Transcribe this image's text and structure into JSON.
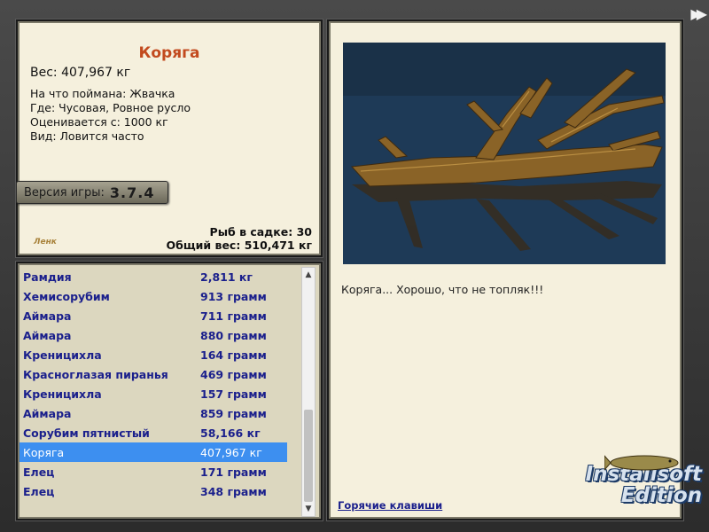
{
  "info": {
    "fish_name": "Коряга",
    "weight_line": "Вес: 407,967 кг",
    "details": [
      "На что поймана: Жвачка",
      "Где: Чусовая, Ровное русло",
      "Оценивается с: 1000 кг",
      "Вид: Ловится часто"
    ],
    "version_label": "Версия игры:",
    "version_value": "3.7.4",
    "logo_text": "Ленк",
    "fish_in_keepnet": "Рыб в садке: 30",
    "total_weight": "Общий вес: 510,471 кг"
  },
  "list": {
    "items": [
      {
        "name": "Рамдия",
        "weight": "2,811 кг"
      },
      {
        "name": "Хемисорубим",
        "weight": "913 грамм"
      },
      {
        "name": "Аймара",
        "weight": "711 грамм"
      },
      {
        "name": "Аймара",
        "weight": "880 грамм"
      },
      {
        "name": "Креницихла",
        "weight": "164 грамм"
      },
      {
        "name": "Красноглазая пиранья",
        "weight": "469 грамм"
      },
      {
        "name": "Креницихла",
        "weight": "157 грамм"
      },
      {
        "name": "Аймара",
        "weight": "859 грамм"
      },
      {
        "name": "Сорубим пятнистый",
        "weight": "58,166 кг"
      },
      {
        "name": "Коряга",
        "weight": "407,967 кг",
        "selected": true
      },
      {
        "name": "Елец",
        "weight": "171 грамм"
      },
      {
        "name": "Елец",
        "weight": "348 грамм"
      }
    ]
  },
  "view": {
    "caption": "Коряга... Хорошо, что не топляк!!!",
    "hotkeys_link": "Горячие клавиши"
  },
  "watermark": {
    "line1": "Installsoft",
    "line2": "Edition"
  },
  "icons": {
    "fast_forward": "fast-forward-icon",
    "scroll_up": "chevron-up-icon",
    "scroll_down": "chevron-down-icon"
  },
  "colors": {
    "title": "#c24a1e",
    "list_text": "#1a1f8c",
    "selected_row": "#3d8ff0",
    "panel_bg": "#f5f0dd"
  }
}
